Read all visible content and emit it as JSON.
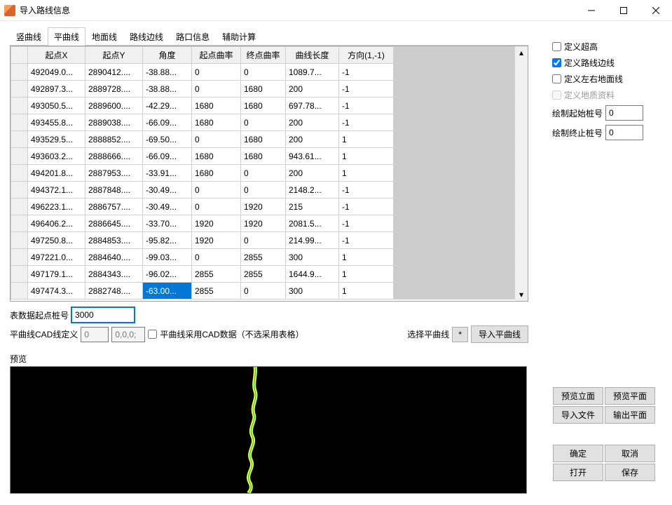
{
  "window": {
    "title": "导入路线信息",
    "minimize": "—",
    "maximize": "☐",
    "close": "✕"
  },
  "tabs": [
    "竖曲线",
    "平曲线",
    "地面线",
    "路线边线",
    "路口信息",
    "辅助计算"
  ],
  "active_tab_index": 1,
  "columns": [
    "起点X",
    "起点Y",
    "角度",
    "起点曲率",
    "终点曲率",
    "曲线长度",
    "方向(1,-1)"
  ],
  "rows": [
    [
      "492049.0...",
      "2890412....",
      "-38.88...",
      "0",
      "0",
      "1089.7...",
      "-1"
    ],
    [
      "492897.3...",
      "2889728....",
      "-38.88...",
      "0",
      "1680",
      "200",
      "-1"
    ],
    [
      "493050.5...",
      "2889600....",
      "-42.29...",
      "1680",
      "1680",
      "697.78...",
      "-1"
    ],
    [
      "493455.8...",
      "2889038....",
      "-66.09...",
      "1680",
      "0",
      "200",
      "-1"
    ],
    [
      "493529.5...",
      "2888852....",
      "-69.50...",
      "0",
      "1680",
      "200",
      "1"
    ],
    [
      "493603.2...",
      "2888666....",
      "-66.09...",
      "1680",
      "1680",
      "943.61...",
      "1"
    ],
    [
      "494201.8...",
      "2887953....",
      "-33.91...",
      "1680",
      "0",
      "200",
      "1"
    ],
    [
      "494372.1...",
      "2887848....",
      "-30.49...",
      "0",
      "0",
      "2148.2...",
      "-1"
    ],
    [
      "496223.1...",
      "2886757....",
      "-30.49...",
      "0",
      "1920",
      "215",
      "-1"
    ],
    [
      "496406.2...",
      "2886645....",
      "-33.70...",
      "1920",
      "1920",
      "2081.5...",
      "-1"
    ],
    [
      "497250.8...",
      "2884853....",
      "-95.82...",
      "1920",
      "0",
      "214.99...",
      "-1"
    ],
    [
      "497221.0...",
      "2884640....",
      "-99.03...",
      "0",
      "2855",
      "300",
      "1"
    ],
    [
      "497179.1...",
      "2884343....",
      "-96.02...",
      "2855",
      "2855",
      "1644.9...",
      "1"
    ],
    [
      "497474.3...",
      "2882748....",
      "-63.00...",
      "2855",
      "0",
      "300",
      "1"
    ]
  ],
  "selected_cell": {
    "row": 13,
    "col": 2
  },
  "form": {
    "start_stake_label": "表数据起点桩号",
    "start_stake_value": "3000",
    "cad_def_label": "平曲线CAD线定义",
    "cad_def_value": "0",
    "cad_def_coords": "0,0,0;",
    "use_cad_checkbox": "平曲线采用CAD数据（不选采用表格）",
    "select_curve_label": "选择平曲线",
    "select_curve_btn": "*",
    "import_curve_btn": "导入平曲线"
  },
  "side": {
    "def_superelev": "定义超高",
    "def_edge": "定义路线边线",
    "def_ground": "定义左右地面线",
    "def_geology": "定义地质资料",
    "start_stake_label": "绘制起始桩号",
    "start_stake_value": "0",
    "end_stake_label": "绘制终止桩号",
    "end_stake_value": "0"
  },
  "preview_label": "预览",
  "right_buttons": {
    "preview_elev": "预览立面",
    "preview_plan": "预览平面",
    "import_file": "导入文件",
    "output_plan": "输出平面"
  },
  "bottom_buttons": {
    "ok": "确定",
    "cancel": "取消",
    "open": "打开",
    "save": "保存"
  }
}
